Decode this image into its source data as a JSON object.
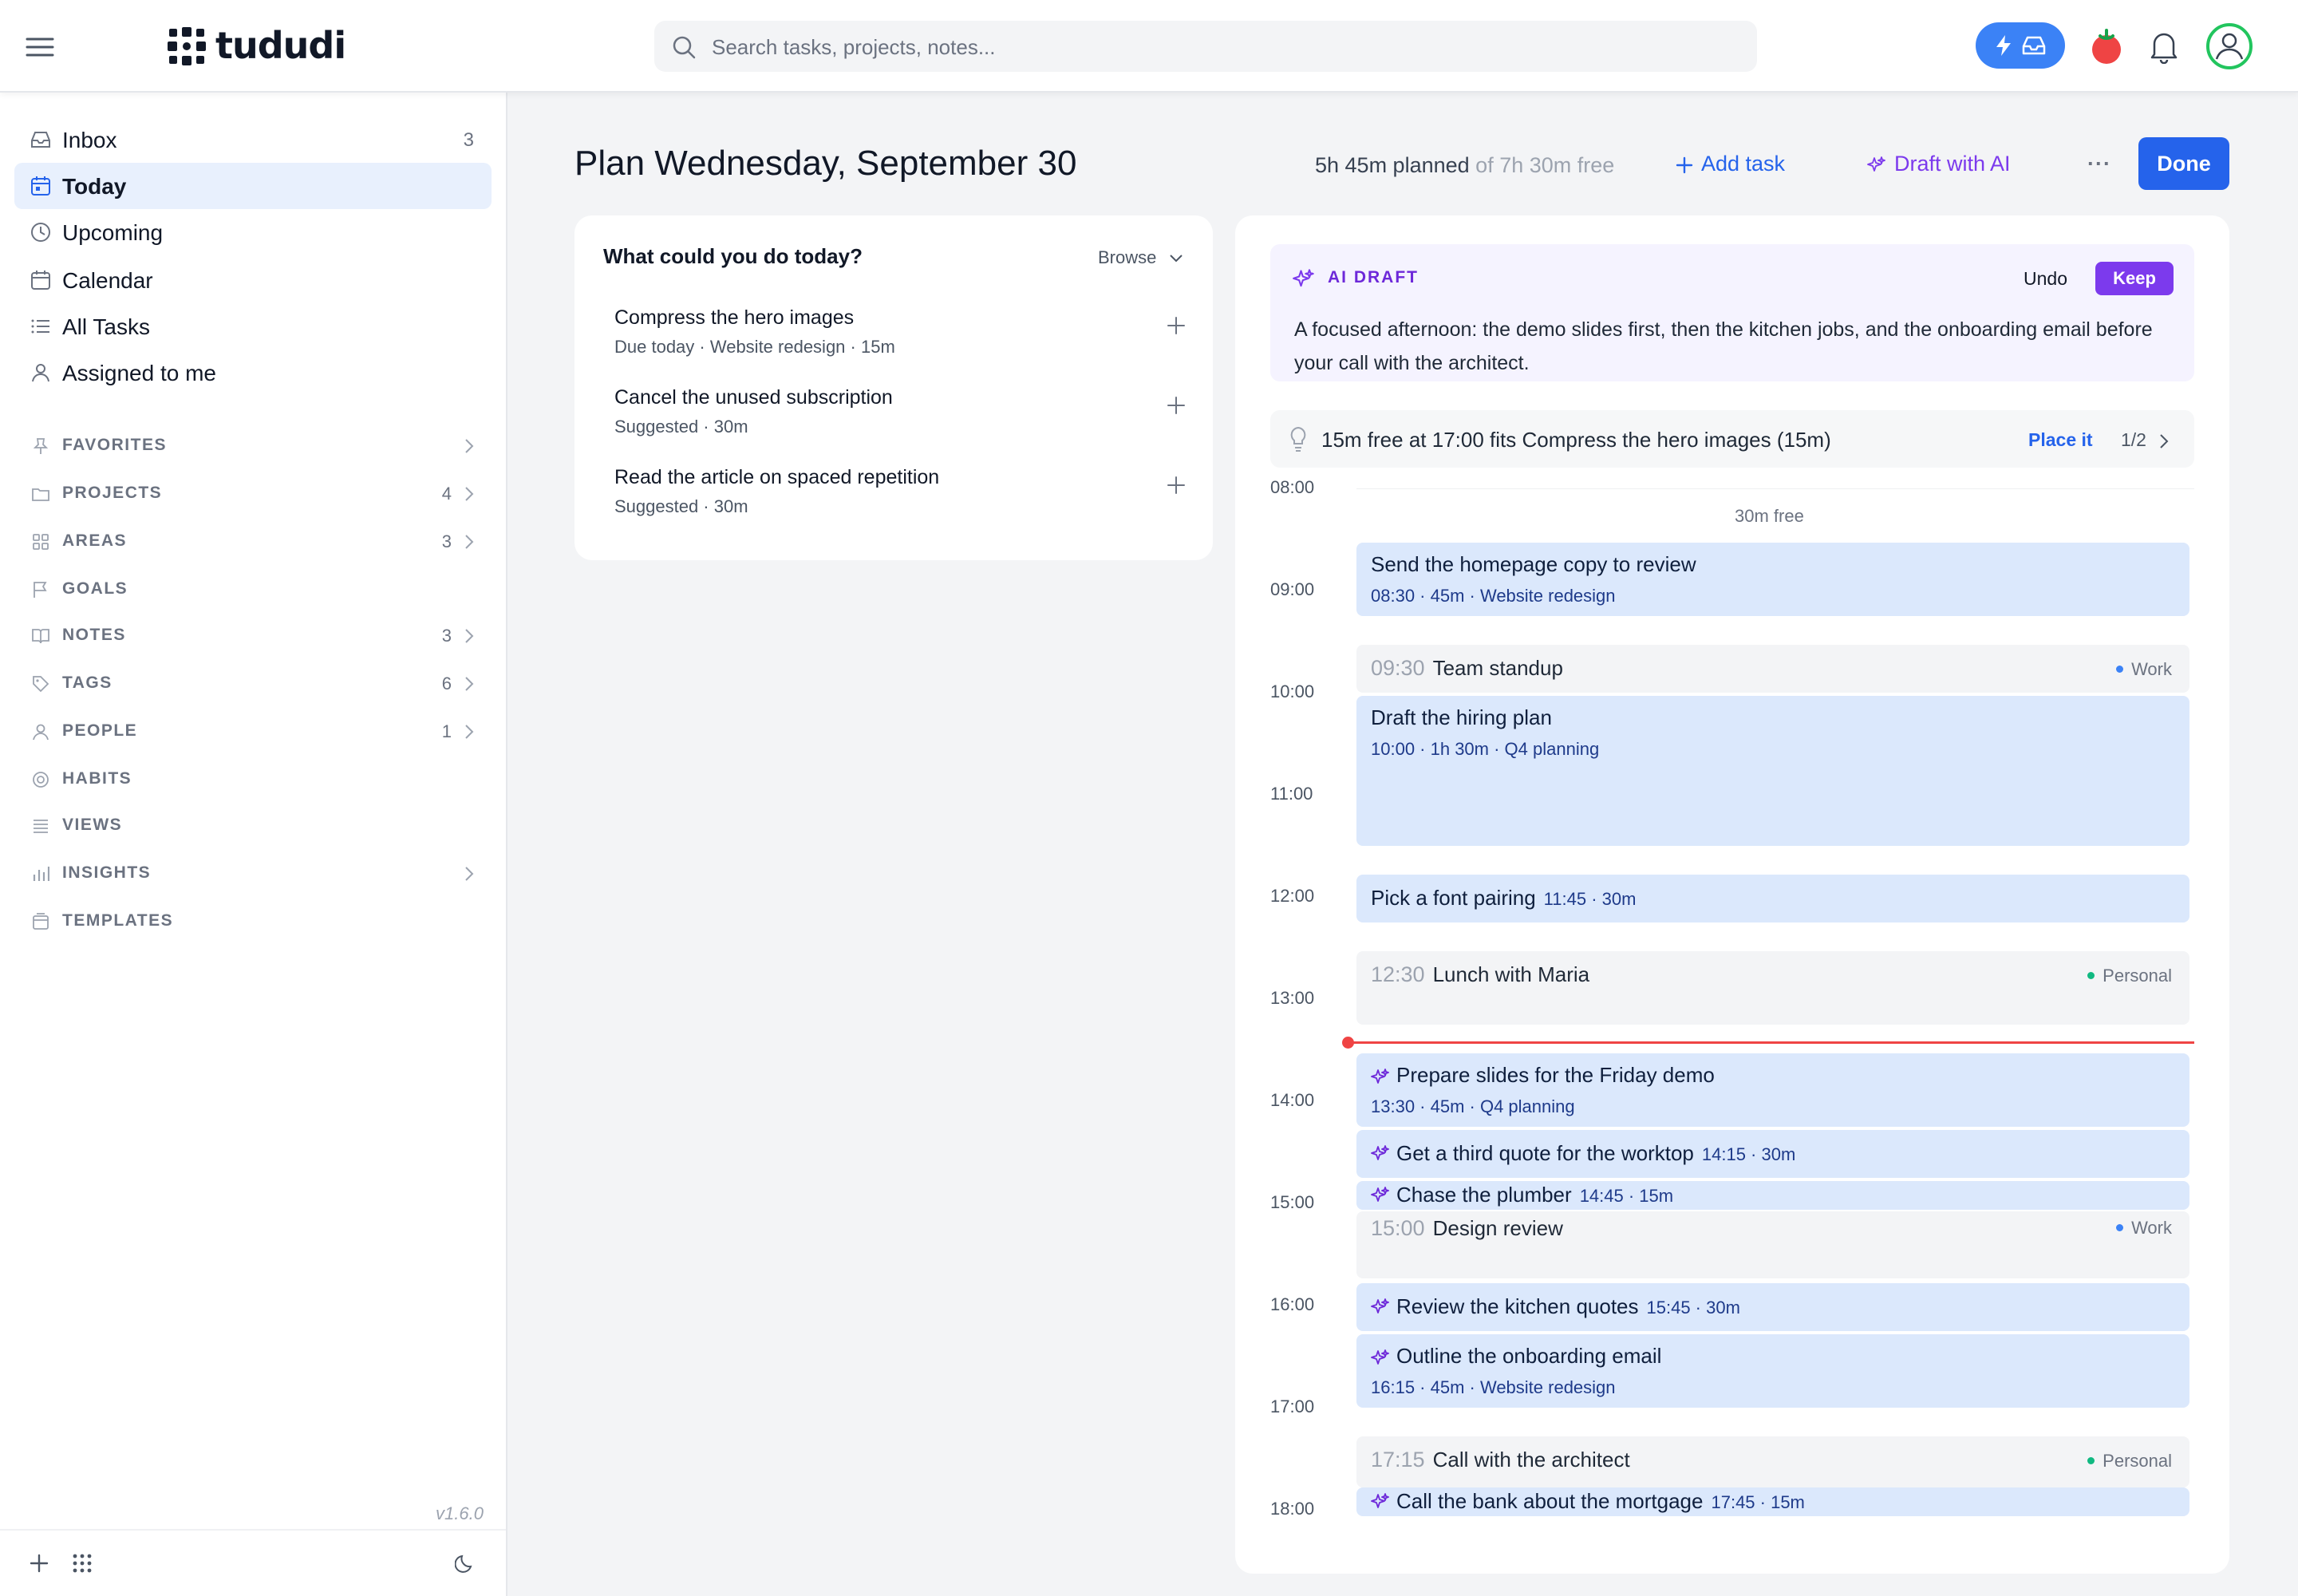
{
  "app": {
    "name": "tududi"
  },
  "search": {
    "placeholder": "Search tasks, projects, notes..."
  },
  "sidebar": {
    "nav": [
      {
        "label": "Inbox",
        "count": "3",
        "icon": "inbox-icon"
      },
      {
        "label": "Today",
        "count": "",
        "icon": "calendar-today-icon",
        "active": true
      },
      {
        "label": "Upcoming",
        "count": "",
        "icon": "clock-icon"
      },
      {
        "label": "Calendar",
        "count": "",
        "icon": "calendar-icon"
      },
      {
        "label": "All Tasks",
        "count": "",
        "icon": "list-icon"
      },
      {
        "label": "Assigned to me",
        "count": "",
        "icon": "user-icon"
      }
    ],
    "sections": [
      {
        "label": "FAVORITES",
        "count": "",
        "icon": "pin-icon"
      },
      {
        "label": "PROJECTS",
        "count": "4",
        "icon": "folder-icon"
      },
      {
        "label": "AREAS",
        "count": "3",
        "icon": "grid-icon"
      },
      {
        "label": "GOALS",
        "count": "",
        "icon": "flag-icon"
      },
      {
        "label": "NOTES",
        "count": "3",
        "icon": "book-icon"
      },
      {
        "label": "TAGS",
        "count": "6",
        "icon": "tag-icon"
      },
      {
        "label": "PEOPLE",
        "count": "1",
        "icon": "people-icon"
      },
      {
        "label": "HABITS",
        "count": "",
        "icon": "habit-icon"
      },
      {
        "label": "VIEWS",
        "count": "",
        "icon": "views-icon"
      },
      {
        "label": "INSIGHTS",
        "count": "",
        "icon": "chart-icon"
      },
      {
        "label": "TEMPLATES",
        "count": "",
        "icon": "template-icon"
      }
    ],
    "version": "v1.6.0"
  },
  "plan": {
    "title": "Plan Wednesday, September 30",
    "planned": "5h 45m planned",
    "free": "of 7h 30m free",
    "add_task": "Add task",
    "draft_ai": "Draft with AI",
    "more": "···",
    "done": "Done"
  },
  "suggestions": {
    "title": "What could you do today?",
    "browse": "Browse",
    "items": [
      {
        "title": "Compress the hero images",
        "meta": "Due today · Website redesign · 15m"
      },
      {
        "title": "Cancel the unused subscription",
        "meta": "Suggested · 30m"
      },
      {
        "title": "Read the article on spaced repetition",
        "meta": "Suggested · 30m"
      }
    ]
  },
  "ai_draft": {
    "label": "AI DRAFT",
    "undo": "Undo",
    "keep": "Keep",
    "description": "A focused afternoon: the demo slides first, then the kitchen jobs, and the onboarding email before your call with the architect."
  },
  "hint": {
    "text": "15m free at 17:00 fits Compress the hero images (15m)",
    "action": "Place it",
    "pager": "1/2"
  },
  "timeline": {
    "hours": [
      "08:00",
      "09:00",
      "10:00",
      "11:00",
      "12:00",
      "13:00",
      "14:00",
      "15:00",
      "16:00",
      "17:00",
      "18:00"
    ],
    "free_gap": "30m free",
    "blocks": [
      {
        "title": "Send the homepage copy to review",
        "meta": "08:30 · 45m · Website redesign",
        "ai": false
      },
      {
        "title": "Draft the hiring plan",
        "meta": "10:00 · 1h 30m · Q4 planning",
        "ai": false
      },
      {
        "title": "Pick a font pairing",
        "meta": "11:45 · 30m",
        "ai": false
      },
      {
        "title": "Prepare slides for the Friday demo",
        "meta": "13:30 · 45m · Q4 planning",
        "ai": true
      },
      {
        "title": "Get a third quote for the worktop",
        "meta": "14:15 · 30m",
        "ai": true
      },
      {
        "title": "Chase the plumber",
        "meta": "14:45 · 15m",
        "ai": true
      },
      {
        "title": "Review the kitchen quotes",
        "meta": "15:45 · 30m",
        "ai": true
      },
      {
        "title": "Outline the onboarding email",
        "meta": "16:15 · 45m · Website redesign",
        "ai": true
      },
      {
        "title": "Call the bank about the mortgage",
        "meta": "17:45 · 15m",
        "ai": true
      }
    ],
    "events": [
      {
        "time": "09:30",
        "title": "Team standup",
        "tag": "Work",
        "color": "#3b82f6"
      },
      {
        "time": "12:30",
        "title": "Lunch with Maria",
        "tag": "Personal",
        "color": "#10b981"
      },
      {
        "time": "15:00",
        "title": "Design review",
        "tag": "Work",
        "color": "#3b82f6"
      },
      {
        "time": "17:15",
        "title": "Call with the architect",
        "tag": "Personal",
        "color": "#10b981"
      }
    ]
  },
  "colors": {
    "accent": "#2563eb",
    "ai": "#7c3aed",
    "now_line": "#ef4444",
    "block": "#dbe8fc"
  }
}
